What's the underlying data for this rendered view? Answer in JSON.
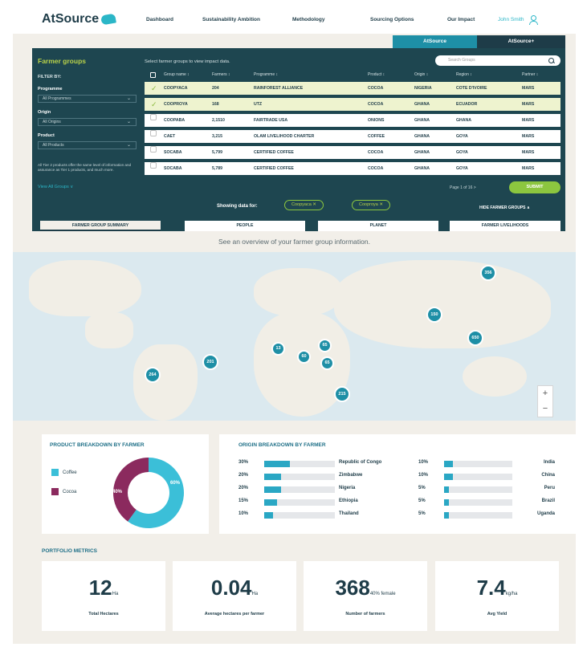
{
  "nav": {
    "logo": "AtSource",
    "links": [
      "Dashboard",
      "Sustainability Ambition",
      "Methodology",
      "Sourcing Options",
      "Our Impact"
    ],
    "user": "John Smith"
  },
  "tabs": {
    "a": "AtSource",
    "b": "AtSource+"
  },
  "filters": {
    "title": "Farmer groups",
    "filter_by": "FILTER BY:",
    "programme_label": "Programme",
    "programme_value": "All Programmes",
    "origin_label": "Origin",
    "origin_value": "All Origins",
    "product_label": "Product",
    "product_value": "All Products",
    "note": "All Tier 2 products offer the same level of information and assurance as Tier 1 products, and much more.",
    "view_all": "View All Groups ∨"
  },
  "table": {
    "hint": "Select farmer groups to view impact data.",
    "search_placeholder": "Search Groups",
    "headers": [
      "Group name ↕",
      "Farmers ↕",
      "Programme ↕",
      "Product ↕",
      "Origin ↕",
      "Region ↕",
      "Partner ↕"
    ],
    "rows": [
      {
        "selected": true,
        "cells": [
          "COOPYACA",
          "204",
          "RAINFOREST ALLIANCE",
          "COCOA",
          "NIGERIA",
          "COTE D'IVOIRE",
          "MARS"
        ]
      },
      {
        "selected": true,
        "cells": [
          "COOPROYA",
          "168",
          "UTZ",
          "COCOA",
          "GHANA",
          "ECUADOR",
          "MARS"
        ]
      },
      {
        "selected": false,
        "cells": [
          "COOPABA",
          "2,1510",
          "FAIRTRADE USA",
          "ONIONS",
          "GHANA",
          "GHANA",
          "MARS"
        ]
      },
      {
        "selected": false,
        "cells": [
          "CAET",
          "3,215",
          "OLAM LIVELIHOOD CHARTER",
          "COFFEE",
          "GHANA",
          "GOYA",
          "MARS"
        ]
      },
      {
        "selected": false,
        "cells": [
          "SOCABA",
          "5,799",
          "CERTIFIED COFFEE",
          "COCOA",
          "GHANA",
          "GOYA",
          "MARS"
        ]
      },
      {
        "selected": false,
        "cells": [
          "SOCABA",
          "5,789",
          "CERTIFIED COFFEE",
          "COCOA",
          "GHANA",
          "GOYA",
          "MARS"
        ]
      }
    ],
    "pagination": "Page 1 of 16  >",
    "submit": "SUBMIT"
  },
  "showing": {
    "label": "Showing data for:",
    "chips": [
      "Coopyaca  ✕",
      "Cooproya  ✕"
    ],
    "hide": "HIDE FARMER GROUPS  ∧"
  },
  "section_tabs": [
    "FARMER GROUP SUMMARY",
    "PEOPLE",
    "PLANET",
    "FARMER LIVELIHOODS"
  ],
  "overview": "See an overview of your farmer group information.",
  "map": {
    "pins": [
      "356",
      "150",
      "650",
      "65",
      "13",
      "60",
      "65",
      "264",
      "201",
      "215"
    ],
    "zoom_in": "+",
    "zoom_out": "−"
  },
  "product_breakdown": {
    "title": "PRODUCT BREAKDOWN BY FARMER",
    "items": [
      {
        "name": "Coffee",
        "pct": "60%",
        "value": 60,
        "color": "#3bbfd8"
      },
      {
        "name": "Cocoa",
        "pct": "40%",
        "value": 40,
        "color": "#8b2a5e"
      }
    ]
  },
  "origin_breakdown": {
    "title": "ORIGIN BREAKDOWN BY FARMER",
    "left": [
      {
        "pct": "30%",
        "value": 30,
        "country": "Republic of Congo"
      },
      {
        "pct": "20%",
        "value": 20,
        "country": "Zimbabwe"
      },
      {
        "pct": "20%",
        "value": 20,
        "country": "Nigeria"
      },
      {
        "pct": "15%",
        "value": 15,
        "country": "Ethiopia"
      },
      {
        "pct": "10%",
        "value": 10,
        "country": "Thailand"
      }
    ],
    "right": [
      {
        "pct": "10%",
        "value": 10,
        "country": "India"
      },
      {
        "pct": "10%",
        "value": 10,
        "country": "China"
      },
      {
        "pct": "5%",
        "value": 5,
        "country": "Peru"
      },
      {
        "pct": "5%",
        "value": 5,
        "country": "Brazil"
      },
      {
        "pct": "5%",
        "value": 5,
        "country": "Uganda"
      }
    ]
  },
  "portfolio": {
    "title": "PORTFOLIO METRICS",
    "metrics": [
      {
        "value": "12",
        "unit": "Ha",
        "label": "Total Hectares"
      },
      {
        "value": "0.04",
        "unit": "Ha",
        "label": "Average hectares per farmer"
      },
      {
        "value": "368",
        "unit": "40% female",
        "label": "Number of farmers"
      },
      {
        "value": "7.4",
        "unit": "kg/ha",
        "label": "Avg Yield"
      }
    ]
  },
  "colors": {
    "brand": "#1e3c48",
    "accent": "#2bb6c7",
    "lime": "#8cc63f",
    "panel": "#1e4650"
  }
}
